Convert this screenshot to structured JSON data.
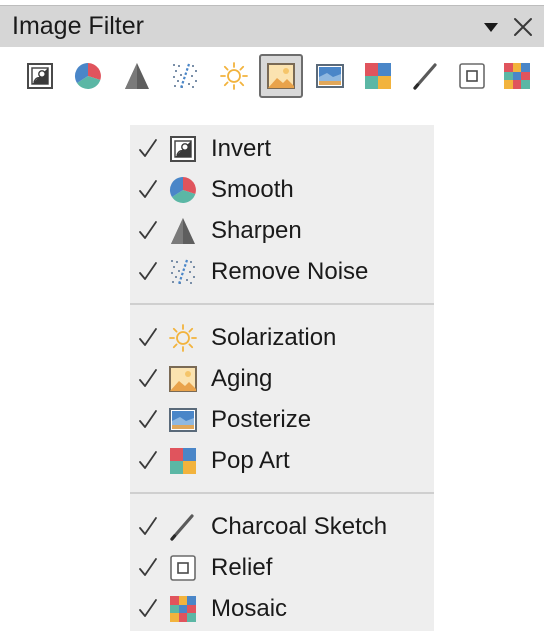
{
  "panel": {
    "title": "Image Filter"
  },
  "toolbar": {
    "buttons": [
      {
        "name": "invert",
        "icon": "invert-icon",
        "active": false
      },
      {
        "name": "smooth",
        "icon": "smooth-icon",
        "active": false
      },
      {
        "name": "sharpen",
        "icon": "sharpen-icon",
        "active": false
      },
      {
        "name": "remove-noise",
        "icon": "remove-noise-icon",
        "active": false
      },
      {
        "name": "solarization",
        "icon": "solarization-icon",
        "active": false
      },
      {
        "name": "aging",
        "icon": "aging-icon",
        "active": true
      },
      {
        "name": "posterize",
        "icon": "posterize-icon",
        "active": false
      },
      {
        "name": "pop-art",
        "icon": "pop-art-icon",
        "active": false
      },
      {
        "name": "charcoal-sketch",
        "icon": "charcoal-sketch-icon",
        "active": false
      },
      {
        "name": "relief",
        "icon": "relief-icon",
        "active": false
      },
      {
        "name": "mosaic",
        "icon": "mosaic-icon",
        "active": false
      }
    ]
  },
  "menu": {
    "groups": [
      {
        "items": [
          {
            "label": "Invert",
            "checked": true,
            "icon": "invert-icon"
          },
          {
            "label": "Smooth",
            "checked": true,
            "icon": "smooth-icon"
          },
          {
            "label": "Sharpen",
            "checked": true,
            "icon": "sharpen-icon"
          },
          {
            "label": "Remove Noise",
            "checked": true,
            "icon": "remove-noise-icon"
          }
        ]
      },
      {
        "items": [
          {
            "label": "Solarization",
            "checked": true,
            "icon": "solarization-icon"
          },
          {
            "label": "Aging",
            "checked": true,
            "icon": "aging-icon"
          },
          {
            "label": "Posterize",
            "checked": true,
            "icon": "posterize-icon"
          },
          {
            "label": "Pop Art",
            "checked": true,
            "icon": "pop-art-icon"
          }
        ]
      },
      {
        "items": [
          {
            "label": "Charcoal Sketch",
            "checked": true,
            "icon": "charcoal-sketch-icon"
          },
          {
            "label": "Relief",
            "checked": true,
            "icon": "relief-icon"
          },
          {
            "label": "Mosaic",
            "checked": true,
            "icon": "mosaic-icon"
          }
        ]
      }
    ]
  },
  "colors": {
    "titlebar_bg": "#d6d6d6",
    "menu_bg": "#eeeeee",
    "active_button_bg": "#d9d9d9",
    "separator": "#cfcfcf"
  }
}
